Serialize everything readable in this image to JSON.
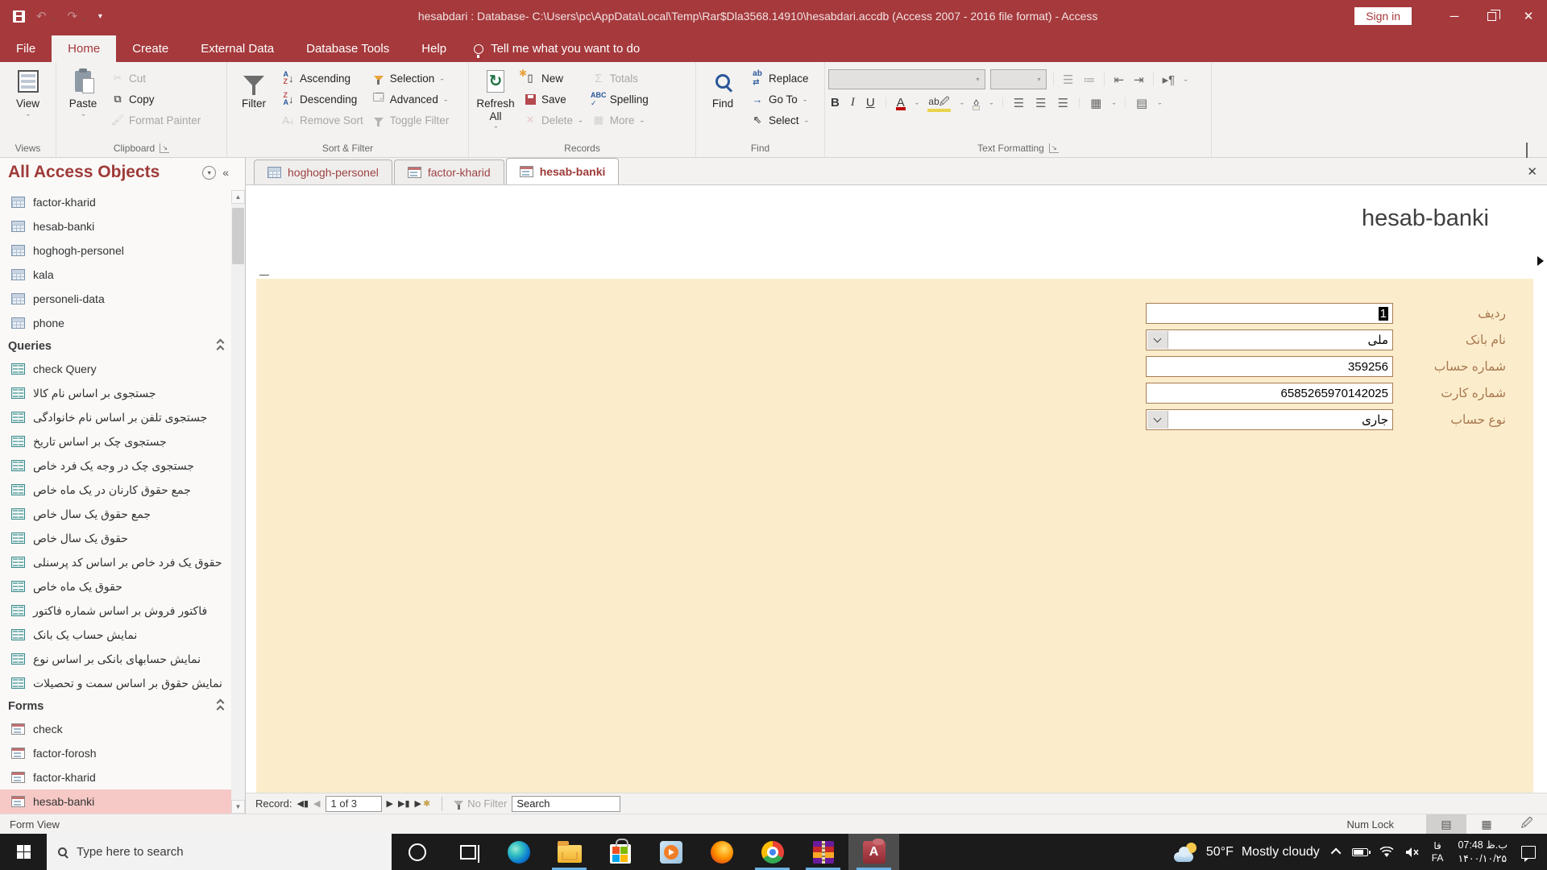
{
  "titlebar": {
    "title": "hesabdari : Database- C:\\Users\\pc\\AppData\\Local\\Temp\\Rar$Dla3568.14910\\hesabdari.accdb (Access 2007 - 2016 file format)  -  Access",
    "sign_in": "Sign in"
  },
  "menu": {
    "tabs": [
      "File",
      "Home",
      "Create",
      "External Data",
      "Database Tools",
      "Help"
    ],
    "active_tab": "Home",
    "tellme": "Tell me what you want to do"
  },
  "ribbon": {
    "views": {
      "label": "Views",
      "view": "View"
    },
    "clipboard": {
      "label": "Clipboard",
      "paste": "Paste",
      "cut": "Cut",
      "copy": "Copy",
      "format_painter": "Format Painter"
    },
    "sort": {
      "label": "Sort & Filter",
      "filter": "Filter",
      "ascending": "Ascending",
      "descending": "Descending",
      "remove_sort": "Remove Sort",
      "selection": "Selection",
      "advanced": "Advanced",
      "toggle_filter": "Toggle Filter"
    },
    "records": {
      "label": "Records",
      "refresh": "Refresh All",
      "new": "New",
      "save": "Save",
      "delete": "Delete",
      "totals": "Totals",
      "spelling": "Spelling",
      "more": "More"
    },
    "find": {
      "label": "Find",
      "find": "Find",
      "replace": "Replace",
      "goto": "Go To",
      "select": "Select"
    },
    "text": {
      "label": "Text Formatting"
    }
  },
  "nav": {
    "title": "All Access Objects",
    "tables": [
      "factor-kharid",
      "hesab-banki",
      "hoghogh-personel",
      "kala",
      "personeli-data",
      "phone"
    ],
    "queries_header": "Queries",
    "queries": [
      "check Query",
      "جستجوی بر اساس نام کالا",
      "جستجوی تلفن بر اساس نام خانوادگی",
      "جستجوی چک بر اساس تاریخ",
      "جستجوی چک در وجه یک فرد خاص",
      "جمع حقوق کارنان در یک ماه خاص",
      "جمع حقوق یک سال خاص",
      "حقوق یک سال خاص",
      "حقوق یک فرد خاص بر اساس کد پرسنلی",
      "حقوق یک ماه خاص",
      "فاکتور فروش بر اساس شماره فاکتور",
      "نمایش حساب یک بانک",
      "نمایش حسابهای بانکی بر اساس نوع",
      "نمایش حقوق بر اساس سمت و تحصیلات"
    ],
    "forms_header": "Forms",
    "forms": [
      "check",
      "factor-forosh",
      "factor-kharid",
      "hesab-banki"
    ],
    "selected_form": "hesab-banki"
  },
  "document": {
    "tabs": [
      {
        "label": "hoghogh-personel",
        "type": "table",
        "active": false
      },
      {
        "label": "factor-kharid",
        "type": "form",
        "active": false
      },
      {
        "label": "hesab-banki",
        "type": "form",
        "active": true
      }
    ],
    "form_title": "hesab-banki",
    "fields": [
      {
        "label": "ردیف",
        "value": "1",
        "type": "text",
        "selected": true
      },
      {
        "label": "نام بانک",
        "value": "ملی",
        "type": "combo",
        "selected": false
      },
      {
        "label": "شماره حساب",
        "value": "359256",
        "type": "text",
        "selected": false
      },
      {
        "label": "شماره کارت",
        "value": "6585265970142025",
        "type": "text",
        "selected": false
      },
      {
        "label": "نوع حساب",
        "value": "جاری",
        "type": "combo",
        "selected": false
      }
    ]
  },
  "recordbar": {
    "record_label": "Record:",
    "position": "1 of 3",
    "no_filter": "No Filter",
    "search": "Search"
  },
  "statusbar": {
    "left": "Form View",
    "numlock": "Num Lock"
  },
  "taskbar": {
    "search_placeholder": "Type here to search",
    "apps": [
      "edge",
      "file-explorer",
      "microsoft-store",
      "media-player",
      "firefox",
      "chrome",
      "winrar",
      "access"
    ],
    "running_apps": [
      "file-explorer",
      "chrome",
      "winrar",
      "access"
    ],
    "active_app": "access",
    "weather_temp": "50°F",
    "weather_desc": "Mostly cloudy",
    "lang_top": "فا",
    "lang_bottom": "FA",
    "time": "ب.ظ 07:48",
    "date": "۱۴۰۰/۱۰/۲۵"
  },
  "colors": {
    "accent_red": "#A5393C",
    "form_cream": "#FBEDCC",
    "field_border": "#A97C50",
    "label_brown": "#A97850",
    "nav_selected_pink": "#F6C9C6",
    "taskbar_underline": "#6CB2E2"
  }
}
